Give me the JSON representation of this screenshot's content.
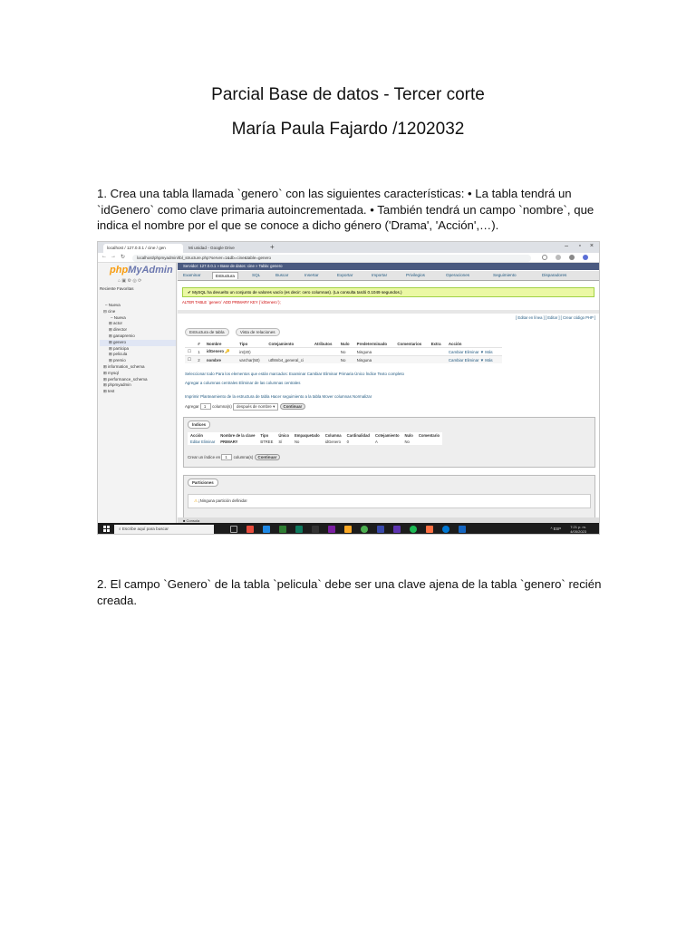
{
  "doc": {
    "title": "Parcial Base de datos - Tercer corte",
    "author": "María Paula Fajardo /1202032",
    "question1": "1. Crea una tabla llamada `genero` con las siguientes características: • La tabla tendrá un `idGenero` como clave primaria autoincrementada. • También tendrá un campo `nombre`, que indica el nombre por el que se conoce a dicho género ('Drama', 'Acción',…).",
    "question2": "2. El campo `Genero` de la tabla `pelicula` debe ser una clave ajena de la tabla `genero` recién creada."
  },
  "screenshot": {
    "browser": {
      "tab1": "localhost / 127.0.0.1 / cine / gen",
      "tab2": "Mi unidad - Google Drive",
      "url": "localhost/phpmyadmin/tbl_structure.php?server=1&db=cine&table=genero"
    },
    "pma": {
      "logo_php": "php",
      "logo_myadmin": "MyAdmin",
      "sidenav": "Reciente   Favoritas",
      "tree": [
        "Nueva",
        "cine",
        "Nueva",
        "actor",
        "director",
        "ganapremio",
        "genero",
        "participa",
        "pelicula",
        "premio",
        "information_schema",
        "mysql",
        "performance_schema",
        "phpmyadmin",
        "test"
      ],
      "breadcrumb": "Servidor: 127.0.0.1 » Base de datos: cine » Tabla: genero",
      "tabs": [
        "Examinar",
        "Estructura",
        "SQL",
        "Buscar",
        "Insertar",
        "Exportar",
        "Importar",
        "Privilegios",
        "Operaciones",
        "Seguimiento",
        "Disparadores"
      ],
      "success": "✔ MySQL ha devuelto un conjunto de valores vacío (es decir: cero columnas). (La consulta tardó 0.1049 segundos.)",
      "sql": "ALTER TABLE `genero` ADD PRIMARY KEY (`idGenero`);",
      "edit_links": "[ Editar en línea ] [ Editar ] [ Crear código PHP ]",
      "subtabs": [
        "Estructura de tabla",
        "Vista de relaciones"
      ],
      "columns_header": [
        "#",
        "Nombre",
        "Tipo",
        "Cotejamiento",
        "Atributos",
        "Nulo",
        "Predeterminado",
        "Comentarios",
        "Extra",
        "Acción"
      ],
      "rows": [
        {
          "n": "1",
          "name": "idGenero",
          "type": "int(20)",
          "coll": "",
          "attr": "",
          "null": "No",
          "def": "Ninguna",
          "actions": "Cambiar  Eliminar  ▼ Más"
        },
        {
          "n": "2",
          "name": "nombre",
          "type": "varchar(50)",
          "coll": "utf8mb4_general_ci",
          "attr": "",
          "null": "No",
          "def": "Ninguna",
          "actions": "Cambiar  Eliminar  ▼ Más"
        }
      ],
      "select_bar": "Seleccionar todo     Para los elementos que están marcados:   Examinar   Cambiar   Eliminar   Primaria   Único   Índice   Texto completo",
      "add_cols": "Agregar a columnas centrales     Eliminar de las columnas centrales",
      "ops_bar": "Imprimir   Planteamiento de la estructura de tabla   Hacer seguimiento a la tabla   Mover columnas   Normalizar",
      "add_label": "Agregar",
      "add_value": "1",
      "add_cols_label": "columna(s)",
      "add_after": "después de nombre",
      "continue": "Continuar",
      "indexes_legend": "Índices",
      "idx_header": [
        "Acción",
        "Nombre de la clave",
        "Tipo",
        "Único",
        "Empaquetado",
        "Columna",
        "Cardinalidad",
        "Cotejamiento",
        "Nulo",
        "Comentario"
      ],
      "idx_row": [
        "Editar  Eliminar",
        "PRIMARY",
        "BTREE",
        "Sí",
        "No",
        "idGenero",
        "0",
        "A",
        "No",
        ""
      ],
      "create_idx_label": "Crear un índice en",
      "create_idx_value": "1",
      "create_idx_cols": "columna(s)",
      "partitions_legend": "Particiones",
      "no_partition": "¡Ninguna partición definida!",
      "console": "Consola"
    },
    "taskbar": {
      "search": "Escribe aquí para buscar",
      "tray": "^  ESP",
      "time": "7:21 p. m.",
      "date": "4/05/2023"
    }
  }
}
